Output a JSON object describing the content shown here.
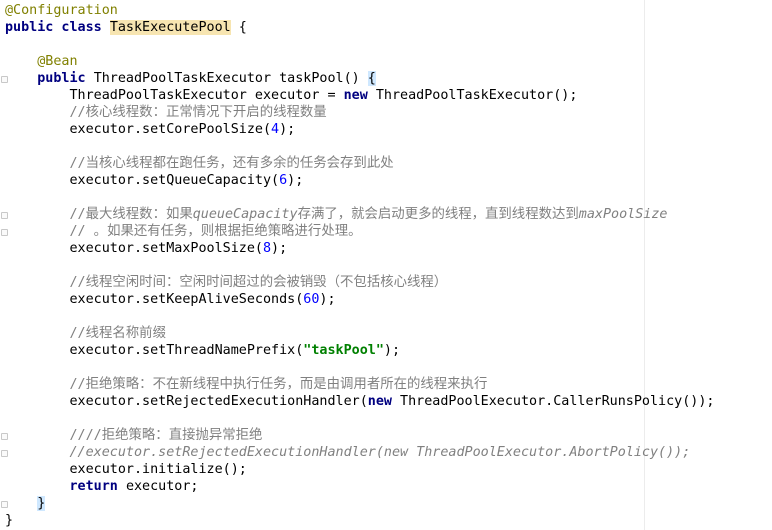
{
  "colors": {
    "background": "#ffffff",
    "keyword": "#000080",
    "annotation": "#808000",
    "number": "#0000ff",
    "string": "#008000",
    "comment": "#808080",
    "class_name_highlight": "#f7e5b1",
    "brace_highlight": "#cfe8ff"
  },
  "code_lines": [
    [
      {
        "t": "@Configuration",
        "c": "ann"
      }
    ],
    [
      {
        "t": "public class ",
        "c": "kw"
      },
      {
        "t": "TaskExecutePool",
        "c": "cls-hl"
      },
      {
        "t": " {",
        "c": ""
      }
    ],
    [],
    [
      {
        "t": "    ",
        "c": ""
      },
      {
        "t": "@Bean",
        "c": "ann"
      }
    ],
    [
      {
        "t": "    ",
        "c": ""
      },
      {
        "t": "public ",
        "c": "kw"
      },
      {
        "t": "ThreadPoolTaskExecutor taskPool() ",
        "c": ""
      },
      {
        "t": "{",
        "c": "brace-hl"
      }
    ],
    [
      {
        "t": "        ThreadPoolTaskExecutor executor = ",
        "c": ""
      },
      {
        "t": "new ",
        "c": "kw"
      },
      {
        "t": "ThreadPoolTaskExecutor();",
        "c": ""
      }
    ],
    [
      {
        "t": "        //核心线程数：正常情况下开启的线程数量",
        "c": "cmt"
      }
    ],
    [
      {
        "t": "        executor.setCorePoolSize(",
        "c": ""
      },
      {
        "t": "4",
        "c": "num"
      },
      {
        "t": ");",
        "c": ""
      }
    ],
    [],
    [
      {
        "t": "        //当核心线程都在跑任务，还有多余的任务会存到此处",
        "c": "cmt"
      }
    ],
    [
      {
        "t": "        executor.setQueueCapacity(",
        "c": ""
      },
      {
        "t": "6",
        "c": "num"
      },
      {
        "t": ");",
        "c": ""
      }
    ],
    [],
    [
      {
        "t": "        //最大线程数：如果",
        "c": "cmt"
      },
      {
        "t": "queueCapacity",
        "c": "cmt-ital"
      },
      {
        "t": "存满了，就会启动更多的线程，直到线程数达到",
        "c": "cmt"
      },
      {
        "t": "maxPoolSize",
        "c": "cmt-ital"
      }
    ],
    [
      {
        "t": "        // 。如果还有任务，则根据拒绝策略进行处理。",
        "c": "cmt"
      }
    ],
    [
      {
        "t": "        executor.setMaxPoolSize(",
        "c": ""
      },
      {
        "t": "8",
        "c": "num"
      },
      {
        "t": ");",
        "c": ""
      }
    ],
    [],
    [
      {
        "t": "        //线程空闲时间：空闲时间超过的会被销毁（不包括核心线程）",
        "c": "cmt"
      }
    ],
    [
      {
        "t": "        executor.setKeepAliveSeconds(",
        "c": ""
      },
      {
        "t": "60",
        "c": "num"
      },
      {
        "t": ");",
        "c": ""
      }
    ],
    [],
    [
      {
        "t": "        //线程名称前缀",
        "c": "cmt"
      }
    ],
    [
      {
        "t": "        executor.setThreadNamePrefix(",
        "c": ""
      },
      {
        "t": "\"taskPool\"",
        "c": "str"
      },
      {
        "t": ");",
        "c": ""
      }
    ],
    [],
    [
      {
        "t": "        //拒绝策略：不在新线程中执行任务，而是由调用者所在的线程来执行",
        "c": "cmt"
      }
    ],
    [
      {
        "t": "        executor.setRejectedExecutionHandler(",
        "c": ""
      },
      {
        "t": "new ",
        "c": "kw"
      },
      {
        "t": "ThreadPoolExecutor.CallerRunsPolicy());",
        "c": ""
      }
    ],
    [],
    [
      {
        "t": "        ////拒绝策略：直接抛异常拒绝",
        "c": "cmt"
      }
    ],
    [
      {
        "t": "        //executor.setRejectedExecutionHandler(new ThreadPoolExecutor.AbortPolicy());",
        "c": "cmt-ital"
      }
    ],
    [
      {
        "t": "        executor.initialize();",
        "c": ""
      }
    ],
    [
      {
        "t": "        ",
        "c": ""
      },
      {
        "t": "return ",
        "c": "kw"
      },
      {
        "t": "executor;",
        "c": ""
      }
    ],
    [
      {
        "t": "    ",
        "c": ""
      },
      {
        "t": "}",
        "c": "brace-hl"
      }
    ],
    [
      {
        "t": "}",
        "c": ""
      }
    ]
  ]
}
